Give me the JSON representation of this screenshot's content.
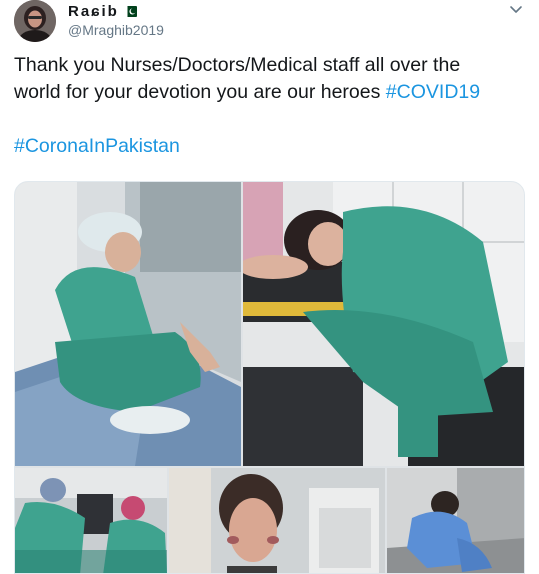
{
  "tweet": {
    "author": {
      "display_name": "Raɕib",
      "flag_icon": "pakistan-flag-icon",
      "handle": "@Mraghib2019"
    },
    "menu_icon": "chevron-down-icon",
    "text": {
      "line1": "Thank you Nurses/Doctors/Medical staff all over the",
      "line2_plain": "world for your devotion you are our heroes ",
      "hashtag1": "#COVID19",
      "hashtag2": "#CoronaInPakistan"
    },
    "media": {
      "count": 5,
      "items": [
        "photo-nurse-crouching-hallway",
        "photo-nurse-sleeping-on-cases",
        "photo-doctors-resting-desk",
        "photo-nurse-face-marks",
        "photo-nurse-sitting-floor"
      ]
    }
  },
  "colors": {
    "link": "#1b95e0",
    "text": "#14171a",
    "secondary": "#657786",
    "scrubs": "#3fa38f"
  }
}
